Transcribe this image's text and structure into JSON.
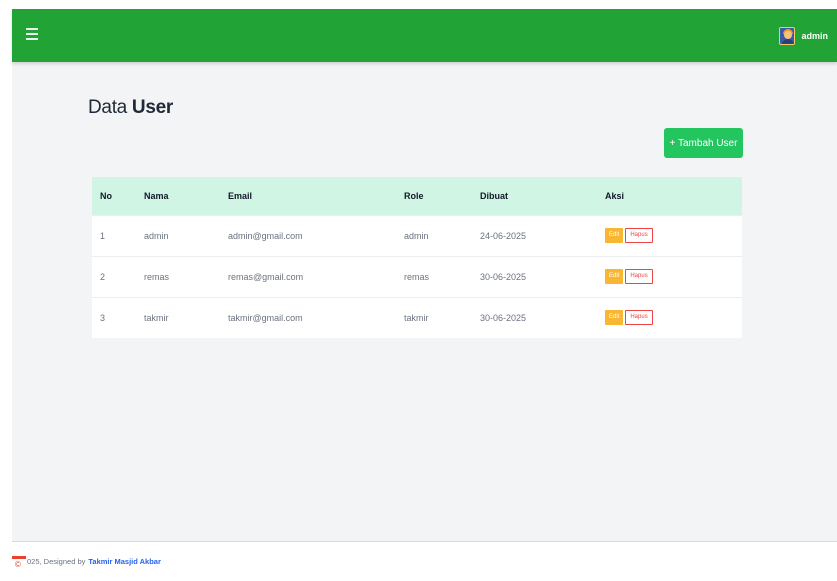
{
  "header": {
    "username": "admin",
    "menu_icon": "hamburger-icon",
    "avatar_icon": "user-avatar-icon"
  },
  "page": {
    "title_prefix": "Data",
    "title_strong": "User",
    "add_button": "+ Tambah User"
  },
  "table": {
    "columns": [
      "No",
      "Nama",
      "Email",
      "Role",
      "Dibuat",
      "Aksi"
    ],
    "rows": [
      {
        "no": "1",
        "nama": "admin",
        "email": "admin@gmail.com",
        "role": "admin",
        "dibuat": "24-06-2025"
      },
      {
        "no": "2",
        "nama": "remas",
        "email": "remas@gmail.com",
        "role": "remas",
        "dibuat": "30-06-2025"
      },
      {
        "no": "3",
        "nama": "takmir",
        "email": "takmir@gmail.com",
        "role": "takmir",
        "dibuat": "30-06-2025"
      }
    ],
    "edit_label": "Edit",
    "delete_label": "Hapus"
  },
  "footer": {
    "text": "025, Designed by",
    "link": "Takmir Masjid Akbar"
  },
  "colors": {
    "topbar": "#22a336",
    "add_button": "#22c55e",
    "header_row": "#d1f5e4",
    "edit": "#f9b731",
    "delete": "#ef4444"
  }
}
